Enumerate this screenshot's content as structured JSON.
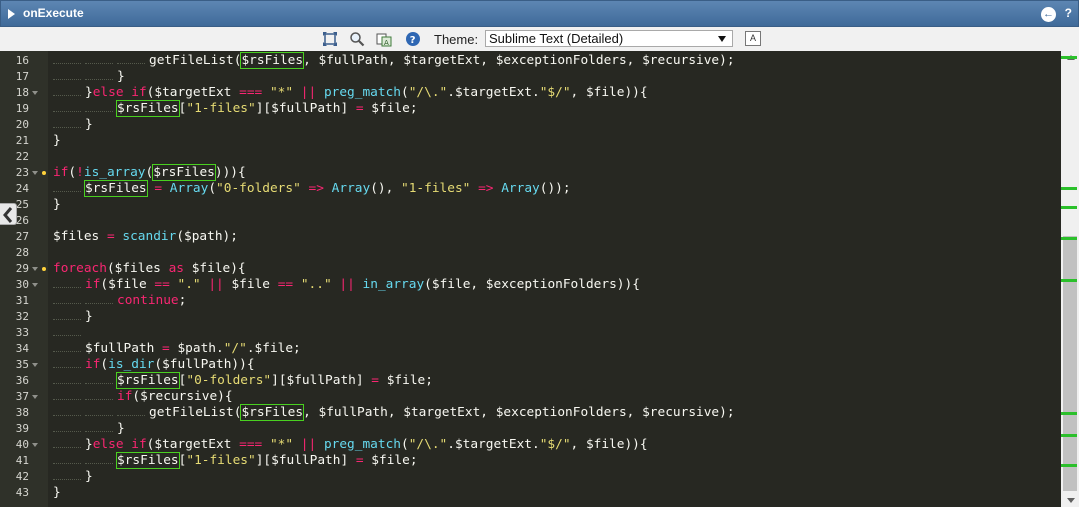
{
  "panel": {
    "title": "onExecute"
  },
  "toolbar": {
    "theme_label": "Theme:",
    "theme_value": "Sublime Text (Detailed)",
    "font_button": "A"
  },
  "colors": {
    "keyword": "#f92672",
    "function": "#a6e22e",
    "string": "#e6db74",
    "builtin": "#66d9ef",
    "background": "#272822",
    "highlight_box": "#49d020",
    "scroll_marker": "#2bc02b"
  },
  "icons": [
    "collapse-arrow-icon",
    "back-icon",
    "help-icon",
    "fullscreen-icon",
    "search-icon",
    "replace-icon",
    "info-icon",
    "side-collapse-icon"
  ],
  "lines": [
    {
      "n": "16",
      "indent": 3,
      "fold": false,
      "dot": false,
      "tokens": [
        [
          "fnw",
          "getFileList("
        ],
        [
          "hl",
          "$rsFiles"
        ],
        [
          "pl",
          ", $fullPath, $targetExt, $exceptionFolders, $recursive);"
        ]
      ]
    },
    {
      "n": "17",
      "indent": 2,
      "fold": false,
      "dot": false,
      "tokens": [
        [
          "pl",
          "}"
        ]
      ]
    },
    {
      "n": "18",
      "indent": 1,
      "fold": true,
      "dot": false,
      "tokens": [
        [
          "pl",
          "}"
        ],
        [
          "kw",
          "else if"
        ],
        [
          "pl",
          "($targetExt "
        ],
        [
          "op",
          "==="
        ],
        [
          "pl",
          " "
        ],
        [
          "str",
          "\"*\""
        ],
        [
          "pl",
          " "
        ],
        [
          "op",
          "||"
        ],
        [
          "pl",
          " "
        ],
        [
          "bi",
          "preg_match"
        ],
        [
          "pl",
          "("
        ],
        [
          "str",
          "\"/\\.\""
        ],
        [
          "pl",
          "."
        ],
        [
          "pl",
          "$targetExt."
        ],
        [
          "str",
          "\"$/\""
        ],
        [
          "pl",
          ", $file)){"
        ]
      ]
    },
    {
      "n": "19",
      "indent": 2,
      "fold": false,
      "dot": false,
      "tokens": [
        [
          "hl",
          "$rsFiles"
        ],
        [
          "pl",
          "["
        ],
        [
          "str",
          "\"1-files\""
        ],
        [
          "pl",
          "][$fullPath] "
        ],
        [
          "op",
          "="
        ],
        [
          "pl",
          " $file;"
        ]
      ]
    },
    {
      "n": "20",
      "indent": 1,
      "fold": false,
      "dot": false,
      "tokens": [
        [
          "pl",
          "}"
        ]
      ]
    },
    {
      "n": "21",
      "indent": 0,
      "fold": false,
      "dot": false,
      "tokens": [
        [
          "pl",
          "}"
        ]
      ]
    },
    {
      "n": "22",
      "indent": 0,
      "fold": false,
      "dot": false,
      "tokens": []
    },
    {
      "n": "23",
      "indent": 0,
      "fold": true,
      "dot": true,
      "tokens": [
        [
          "kw",
          "if"
        ],
        [
          "pl",
          "("
        ],
        [
          "op",
          "!"
        ],
        [
          "bi",
          "is_array"
        ],
        [
          "pl",
          "("
        ],
        [
          "hl",
          "$rsFiles"
        ],
        [
          "pl",
          "))){"
        ]
      ]
    },
    {
      "n": "24",
      "indent": 1,
      "fold": false,
      "dot": false,
      "tokens": [
        [
          "hl",
          "$rsFiles"
        ],
        [
          "pl",
          " "
        ],
        [
          "op",
          "="
        ],
        [
          "pl",
          " "
        ],
        [
          "bi",
          "Array"
        ],
        [
          "pl",
          "("
        ],
        [
          "str",
          "\"0-folders\""
        ],
        [
          "pl",
          " "
        ],
        [
          "op",
          "=>"
        ],
        [
          "pl",
          " "
        ],
        [
          "bi",
          "Array"
        ],
        [
          "pl",
          "(), "
        ],
        [
          "str",
          "\"1-files\""
        ],
        [
          "pl",
          " "
        ],
        [
          "op",
          "=>"
        ],
        [
          "pl",
          " "
        ],
        [
          "bi",
          "Array"
        ],
        [
          "pl",
          "());"
        ]
      ]
    },
    {
      "n": "25",
      "indent": 0,
      "fold": false,
      "dot": false,
      "tokens": [
        [
          "pl",
          "}"
        ]
      ]
    },
    {
      "n": "26",
      "indent": 0,
      "fold": false,
      "dot": false,
      "tokens": []
    },
    {
      "n": "27",
      "indent": 0,
      "fold": false,
      "dot": false,
      "tokens": [
        [
          "pl",
          "$files "
        ],
        [
          "op",
          "="
        ],
        [
          "pl",
          " "
        ],
        [
          "bi",
          "scandir"
        ],
        [
          "pl",
          "($path);"
        ]
      ]
    },
    {
      "n": "28",
      "indent": 0,
      "fold": false,
      "dot": false,
      "tokens": []
    },
    {
      "n": "29",
      "indent": 0,
      "fold": true,
      "dot": true,
      "tokens": [
        [
          "kw",
          "foreach"
        ],
        [
          "pl",
          "($files "
        ],
        [
          "kw",
          "as"
        ],
        [
          "pl",
          " $file){"
        ]
      ]
    },
    {
      "n": "30",
      "indent": 1,
      "fold": true,
      "dot": false,
      "tokens": [
        [
          "kw",
          "if"
        ],
        [
          "pl",
          "($file "
        ],
        [
          "op",
          "=="
        ],
        [
          "pl",
          " "
        ],
        [
          "str",
          "\".\""
        ],
        [
          "pl",
          " "
        ],
        [
          "op",
          "||"
        ],
        [
          "pl",
          " $file "
        ],
        [
          "op",
          "=="
        ],
        [
          "pl",
          " "
        ],
        [
          "str",
          "\"..\""
        ],
        [
          "pl",
          " "
        ],
        [
          "op",
          "||"
        ],
        [
          "pl",
          " "
        ],
        [
          "bi",
          "in_array"
        ],
        [
          "pl",
          "($file, $exceptionFolders)){"
        ]
      ]
    },
    {
      "n": "31",
      "indent": 2,
      "fold": false,
      "dot": false,
      "tokens": [
        [
          "kw",
          "continue"
        ],
        [
          "pl",
          ";"
        ]
      ]
    },
    {
      "n": "32",
      "indent": 1,
      "fold": false,
      "dot": false,
      "tokens": [
        [
          "pl",
          "}"
        ]
      ]
    },
    {
      "n": "33",
      "indent": 1,
      "fold": false,
      "dot": false,
      "tokens": []
    },
    {
      "n": "34",
      "indent": 1,
      "fold": false,
      "dot": false,
      "tokens": [
        [
          "pl",
          "$fullPath "
        ],
        [
          "op",
          "="
        ],
        [
          "pl",
          " $path."
        ],
        [
          "str",
          "\"/\""
        ],
        [
          "pl",
          ".$file;"
        ]
      ]
    },
    {
      "n": "35",
      "indent": 1,
      "fold": true,
      "dot": false,
      "tokens": [
        [
          "kw",
          "if"
        ],
        [
          "pl",
          "("
        ],
        [
          "bi",
          "is_dir"
        ],
        [
          "pl",
          "($fullPath)){"
        ]
      ]
    },
    {
      "n": "36",
      "indent": 2,
      "fold": false,
      "dot": false,
      "tokens": [
        [
          "hl",
          "$rsFiles"
        ],
        [
          "pl",
          "["
        ],
        [
          "str",
          "\"0-folders\""
        ],
        [
          "pl",
          "][$fullPath] "
        ],
        [
          "op",
          "="
        ],
        [
          "pl",
          " $file;"
        ]
      ]
    },
    {
      "n": "37",
      "indent": 2,
      "fold": true,
      "dot": false,
      "tokens": [
        [
          "kw",
          "if"
        ],
        [
          "pl",
          "($recursive){"
        ]
      ]
    },
    {
      "n": "38",
      "indent": 3,
      "fold": false,
      "dot": false,
      "tokens": [
        [
          "fnw",
          "getFileList("
        ],
        [
          "hl",
          "$rsFiles"
        ],
        [
          "pl",
          ", $fullPath, $targetExt, $exceptionFolders, $recursive);"
        ]
      ]
    },
    {
      "n": "39",
      "indent": 2,
      "fold": false,
      "dot": false,
      "tokens": [
        [
          "pl",
          "}"
        ]
      ]
    },
    {
      "n": "40",
      "indent": 1,
      "fold": true,
      "dot": false,
      "tokens": [
        [
          "pl",
          "}"
        ],
        [
          "kw",
          "else if"
        ],
        [
          "pl",
          "($targetExt "
        ],
        [
          "op",
          "==="
        ],
        [
          "pl",
          " "
        ],
        [
          "str",
          "\"*\""
        ],
        [
          "pl",
          " "
        ],
        [
          "op",
          "||"
        ],
        [
          "pl",
          " "
        ],
        [
          "bi",
          "preg_match"
        ],
        [
          "pl",
          "("
        ],
        [
          "str",
          "\"/\\.\""
        ],
        [
          "pl",
          "."
        ],
        [
          "pl",
          "$targetExt."
        ],
        [
          "str",
          "\"$/\""
        ],
        [
          "pl",
          ", $file)){"
        ]
      ]
    },
    {
      "n": "41",
      "indent": 2,
      "fold": false,
      "dot": false,
      "tokens": [
        [
          "hl",
          "$rsFiles"
        ],
        [
          "pl",
          "["
        ],
        [
          "str",
          "\"1-files\""
        ],
        [
          "pl",
          "][$fullPath] "
        ],
        [
          "op",
          "="
        ],
        [
          "pl",
          " $file;"
        ]
      ]
    },
    {
      "n": "42",
      "indent": 1,
      "fold": false,
      "dot": false,
      "tokens": [
        [
          "pl",
          "}"
        ]
      ]
    },
    {
      "n": "43",
      "indent": 0,
      "fold": false,
      "dot": false,
      "tokens": [
        [
          "pl",
          "}"
        ]
      ]
    }
  ]
}
